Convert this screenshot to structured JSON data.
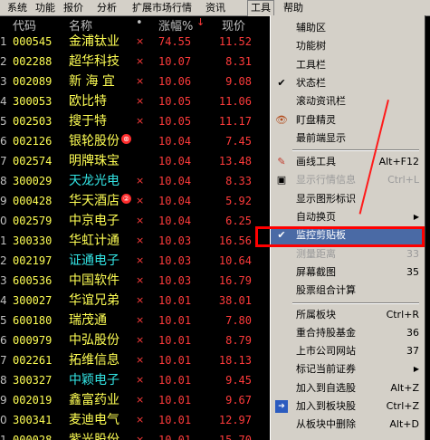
{
  "menubar": {
    "items": [
      "系统",
      "功能",
      "报价",
      "分析",
      "扩展市场行情",
      "资讯",
      "工具",
      "帮助"
    ]
  },
  "table": {
    "headers": {
      "code": "代码",
      "name": "名称",
      "dot": "•",
      "chg": "涨幅%",
      "price": "现价",
      "sort_icon": "↓"
    },
    "rows": [
      {
        "n": "1",
        "code": "000545",
        "name": "金浦钛业",
        "x": "×",
        "chg": "74.55",
        "price": "11.52",
        "cyan": false
      },
      {
        "n": "2",
        "code": "002288",
        "name": "超华科技",
        "x": "×",
        "chg": "10.07",
        "price": "8.31",
        "cyan": false
      },
      {
        "n": "3",
        "code": "002089",
        "name": "新 海 宜",
        "x": "×",
        "chg": "10.06",
        "price": "9.08",
        "cyan": false
      },
      {
        "n": "4",
        "code": "300053",
        "name": "欧比特",
        "x": "×",
        "chg": "10.05",
        "price": "11.06",
        "cyan": false
      },
      {
        "n": "5",
        "code": "002503",
        "name": "搜于特",
        "x": "×",
        "chg": "10.05",
        "price": "11.17",
        "cyan": false
      },
      {
        "n": "6",
        "code": "002126",
        "name": "银轮股份",
        "badge": "⊛",
        "x": "",
        "chg": "10.04",
        "price": "7.45",
        "cyan": false
      },
      {
        "n": "7",
        "code": "002574",
        "name": "明牌珠宝",
        "x": "",
        "chg": "10.04",
        "price": "13.48",
        "cyan": false
      },
      {
        "n": "8",
        "code": "300029",
        "name": "天龙光电",
        "x": "×",
        "chg": "10.04",
        "price": "8.33",
        "cyan": true
      },
      {
        "n": "9",
        "code": "000428",
        "name": "华天酒店",
        "badge": "②",
        "x": "×",
        "chg": "10.04",
        "price": "5.92",
        "cyan": false
      },
      {
        "n": "0",
        "code": "002579",
        "name": "中京电子",
        "x": "×",
        "chg": "10.04",
        "price": "6.25",
        "cyan": false
      },
      {
        "n": "1",
        "code": "300330",
        "name": "华虹计通",
        "x": "×",
        "chg": "10.03",
        "price": "16.56",
        "cyan": false
      },
      {
        "n": "2",
        "code": "002197",
        "name": "证通电子",
        "x": "×",
        "chg": "10.03",
        "price": "10.64",
        "cyan": true
      },
      {
        "n": "3",
        "code": "600536",
        "name": "中国软件",
        "x": "×",
        "chg": "10.03",
        "price": "16.79",
        "cyan": false
      },
      {
        "n": "4",
        "code": "300027",
        "name": "华谊兄弟",
        "x": "×",
        "chg": "10.01",
        "price": "38.01",
        "cyan": false
      },
      {
        "n": "5",
        "code": "600180",
        "name": "瑞茂通",
        "x": "×",
        "chg": "10.01",
        "price": "7.80",
        "cyan": false
      },
      {
        "n": "6",
        "code": "000979",
        "name": "中弘股份",
        "x": "×",
        "chg": "10.01",
        "price": "8.79",
        "cyan": false
      },
      {
        "n": "7",
        "code": "002261",
        "name": "拓维信息",
        "x": "×",
        "chg": "10.01",
        "price": "18.13",
        "cyan": false
      },
      {
        "n": "8",
        "code": "300327",
        "name": "中颖电子",
        "x": "×",
        "chg": "10.01",
        "price": "9.45",
        "cyan": true
      },
      {
        "n": "9",
        "code": "002019",
        "name": "鑫富药业",
        "x": "×",
        "chg": "10.01",
        "price": "9.67",
        "cyan": false
      },
      {
        "n": "0",
        "code": "300341",
        "name": "麦迪电气",
        "x": "×",
        "chg": "10.01",
        "price": "12.97",
        "cyan": false
      },
      {
        "n": "1",
        "code": "000028",
        "name": "紫光股份",
        "x": "×",
        "chg": "10.01",
        "price": "15.70",
        "cyan": false
      }
    ]
  },
  "dropdown": {
    "items": [
      {
        "label": "辅助区",
        "shortcut": "",
        "icon": "",
        "disabled": false
      },
      {
        "label": "功能树",
        "shortcut": "",
        "icon": "",
        "disabled": false
      },
      {
        "label": "工具栏",
        "shortcut": "",
        "icon": "",
        "disabled": false
      },
      {
        "label": "状态栏",
        "shortcut": "",
        "icon": "check-icon",
        "disabled": false
      },
      {
        "label": "滚动资讯栏",
        "shortcut": "",
        "icon": "",
        "disabled": false
      },
      {
        "label": "盯盘精灵",
        "shortcut": "",
        "icon": "eye-icon",
        "disabled": false
      },
      {
        "label": "最前端显示",
        "shortcut": "",
        "icon": "",
        "disabled": false
      },
      {
        "sep": true
      },
      {
        "label": "画线工具",
        "shortcut": "Alt+F12",
        "icon": "pencil-icon",
        "disabled": false
      },
      {
        "label": "显示行情信息",
        "shortcut": "Ctrl+L",
        "icon": "info-icon",
        "disabled": true
      },
      {
        "label": "显示图形标识",
        "shortcut": "",
        "icon": "",
        "disabled": false
      },
      {
        "label": "自动换页",
        "shortcut": "",
        "icon": "",
        "disabled": false,
        "submenu": true
      },
      {
        "label": "监控剪贴板",
        "shortcut": "",
        "icon": "check-icon",
        "disabled": false,
        "highlight": true
      },
      {
        "label": "测量距离",
        "shortcut": "33",
        "icon": "",
        "disabled": true
      },
      {
        "label": "屏幕截图",
        "shortcut": "35",
        "icon": "",
        "disabled": false
      },
      {
        "label": "股票组合计算",
        "shortcut": "",
        "icon": "",
        "disabled": false
      },
      {
        "sep": true
      },
      {
        "label": "所属板块",
        "shortcut": "Ctrl+R",
        "icon": "",
        "disabled": false
      },
      {
        "label": "重合持股基金",
        "shortcut": "36",
        "icon": "",
        "disabled": false
      },
      {
        "label": "上市公司网站",
        "shortcut": "37",
        "icon": "",
        "disabled": false
      },
      {
        "label": "标记当前证券",
        "shortcut": "",
        "icon": "",
        "disabled": false,
        "submenu": true
      },
      {
        "label": "加入到自选股",
        "shortcut": "Alt+Z",
        "icon": "",
        "disabled": false
      },
      {
        "label": "加入到板块股",
        "shortcut": "Ctrl+Z",
        "icon": "add-block-icon",
        "disabled": false
      },
      {
        "label": "从板块中删除",
        "shortcut": "Alt+D",
        "icon": "",
        "disabled": false
      }
    ]
  },
  "colors": {
    "menu_bg": "#d4d0c8",
    "highlight": "#4a6aa5",
    "stock_yellow": "#ffff54",
    "stock_cyan": "#33e6e6",
    "up_red": "#ff3b3b",
    "annotation": "#ff0000"
  }
}
